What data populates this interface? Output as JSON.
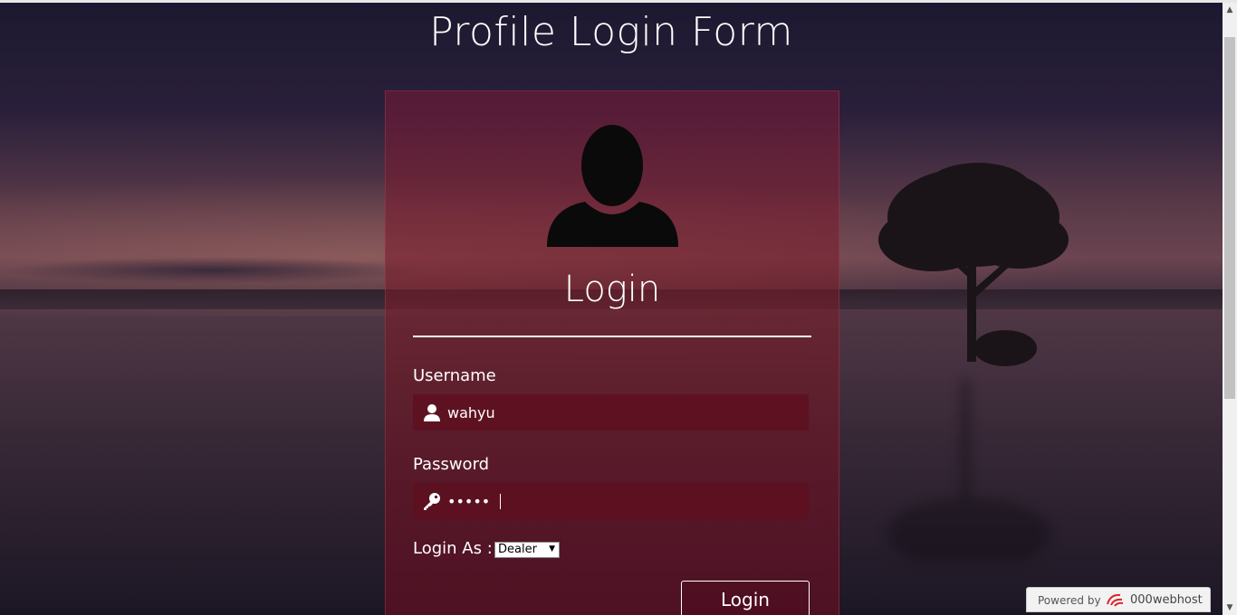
{
  "page": {
    "title": "Profile Login Form"
  },
  "panel": {
    "heading": "Login",
    "username": {
      "label": "Username",
      "value": "wahyu"
    },
    "password": {
      "label": "Password",
      "value": "•••••"
    },
    "login_as": {
      "label": "Login As :",
      "selected": "Dealer"
    },
    "submit_label": "Login"
  },
  "badge": {
    "prefix": "Powered by",
    "brand": "000webhost"
  },
  "colors": {
    "panel_tint": "#7a1937",
    "field_bg": "#5f0f1e",
    "text": "#ffffff"
  },
  "icons": {
    "avatar": "user-silhouette-icon",
    "username": "user-icon",
    "password": "key-icon",
    "select": "dropdown-arrow-icon",
    "badge": "000webhost-logo"
  }
}
